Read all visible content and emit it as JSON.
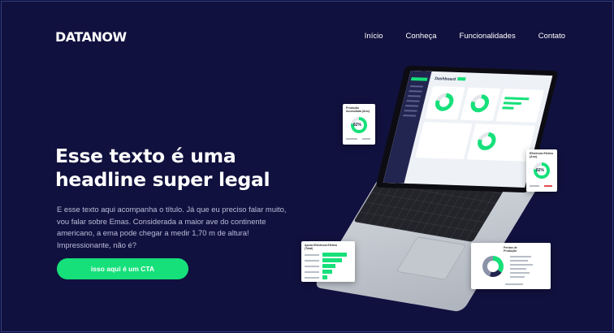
{
  "brand": {
    "logo": "DATANOW"
  },
  "nav": {
    "items": [
      "Início",
      "Conheça",
      "Funcionalidades",
      "Contato"
    ]
  },
  "hero": {
    "headline_line1": "Esse texto é uma",
    "headline_line2": "headline super legal",
    "description": "E esse texto aqui acompanha o título. Já que eu preciso falar muito, vou falar sobre Emas. Considerada a maior ave do continente americano, a ema pode chegar a medir 1,70 m de altura! Impressionante, não é?",
    "cta_label": "isso aqui é um CTA"
  },
  "colors": {
    "background": "#11113f",
    "accent": "#16e07a",
    "text_muted": "#b9bdd8"
  },
  "illustration": {
    "dashboard_title": "Dashboard",
    "card_left_title": "Produção Acumulada (Ano)",
    "card_left_value": "82%",
    "card_right_title": "Eficiência Efetiva (Ano)",
    "card_right_value": "82%",
    "card_bottom_left_title": "Apura Eficiência Efetiva (Total)",
    "card_bottom_right_title": "Perdas de Produção"
  }
}
